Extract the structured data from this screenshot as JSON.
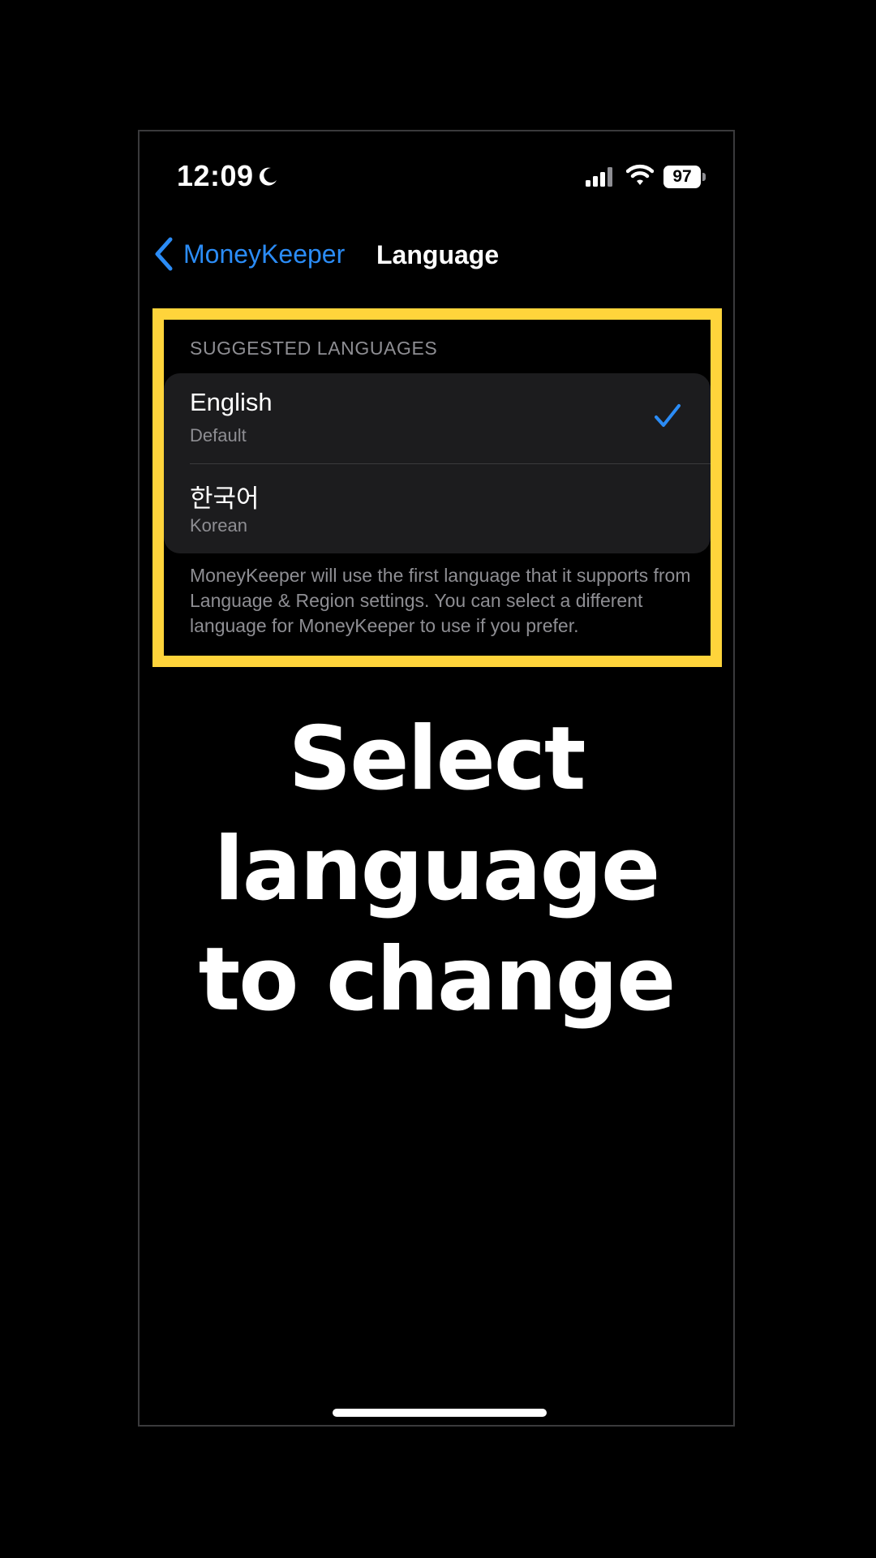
{
  "status_bar": {
    "time": "12:09",
    "battery": "97",
    "icons": [
      "moon-icon",
      "signal-icon",
      "wifi-icon",
      "battery-icon"
    ]
  },
  "nav": {
    "back_label": "MoneyKeeper",
    "title": "Language"
  },
  "section": {
    "header": "SUGGESTED LANGUAGES",
    "items": [
      {
        "title": "English",
        "subtitle": "Default",
        "selected": true
      },
      {
        "title": "한국어",
        "subtitle": "Korean",
        "selected": false
      }
    ],
    "footer": "MoneyKeeper will use the first language that it supports from Language & Region settings. You can select a different language for MoneyKeeper to use if you prefer."
  },
  "caption": {
    "line1": "Select",
    "line2": "language",
    "line3": "to change"
  },
  "colors": {
    "accent": "#2b8cf6",
    "highlight": "#ffd43b",
    "background": "#000000",
    "cell": "#1c1c1e",
    "secondary_text": "#8e8e93"
  }
}
